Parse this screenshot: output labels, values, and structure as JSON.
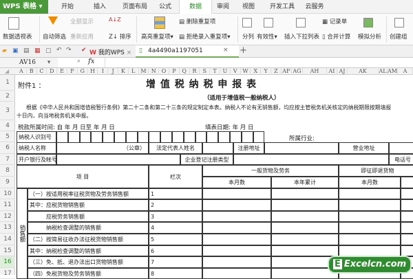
{
  "app": {
    "name": "WPS 表格"
  },
  "ribbon_tabs": [
    "开始",
    "插入",
    "页面布局",
    "公式",
    "数据",
    "审阅",
    "视图",
    "开发工具",
    "云服务"
  ],
  "ribbon": {
    "pivot": "数据透视表",
    "autofilter": "自动筛选",
    "show_all": "全部显示",
    "reapply": "重新应用",
    "sort": "排序",
    "highlight_dup": "高亮重复项",
    "delete_dup": "删除重复项",
    "reject_dup": "拒绝录入重复项",
    "split": "分列",
    "validity": "有效性",
    "insert_dropdown": "插入下拉列表",
    "record": "记录单",
    "consolidate": "合并计算",
    "whatif": "模拟分析",
    "group": "创建组"
  },
  "doc_tabs": {
    "home": "我的WPS",
    "file": "4a4490a1197051"
  },
  "formula": {
    "cell_ref": "AV16",
    "fx": "fx",
    "value": ""
  },
  "columns": [
    "A",
    "B",
    "C",
    "D",
    "E",
    "F",
    "G",
    "H",
    "I",
    "J",
    "K",
    "L",
    "M",
    "N",
    "O",
    "P",
    "Q",
    "R",
    "S",
    "T",
    "U",
    "V",
    "W",
    "X",
    "Y",
    "Z",
    "AF",
    "AG",
    "AH",
    "AI",
    "AJ",
    "AK",
    "AL",
    "AM",
    "A"
  ],
  "rows": [
    "1",
    "2",
    "3",
    "4",
    "5",
    "6",
    "7",
    "8",
    "9",
    "10",
    "11",
    "12",
    "13",
    "14",
    "15",
    "16",
    "17"
  ],
  "sheet": {
    "attachment": "附件1 ：",
    "title": "增 值 税 纳 税 申 报 表",
    "subtitle": "（适用于增值税一般纳税人）",
    "intro1": "根据《中华人民共和国增值税暂行条例》第二十二条和第二十三条的规定制定本表。纳税人不论有无销售额，均应按主管税务机关核定的纳税期限按期填报",
    "intro2": "十日内，向当地税务机关申报。",
    "period": "税款所属时间:  自    年    月    日至    年    月    日",
    "fill_date": "填表日期:    年   月  日",
    "taxpayer_id": "纳税人识别号",
    "industry": "所属行业:",
    "taxpayer_name": "纳税人名称",
    "seal": "（公章）",
    "legal_rep": "法定代表人姓名",
    "reg_addr": "注册地址",
    "biz_addr": "营业地址",
    "bank": "开户银行及帐号",
    "reg_type": "企业登记注册类型",
    "phone": "电话号",
    "item": "项    目",
    "col_no": "栏次",
    "general": "一般货物及劳务",
    "immediate": "即征即退货物",
    "month": "本月数",
    "year": "本年累计",
    "month2": "本月数",
    "sales_group": "销售额",
    "items": [
      {
        "label": "（一）按适用税率征税货物及劳务销售额",
        "no": "1"
      },
      {
        "label": "其中：应税货物销售额",
        "no": "2"
      },
      {
        "label": "　　　应税劳务销售额",
        "no": "3"
      },
      {
        "label": "　　　纳税检查调整的销售额",
        "no": "4"
      },
      {
        "label": "（二）按简易征收办法征税货物销售额",
        "no": "5"
      },
      {
        "label": "其中：纳税检查调整的销售额",
        "no": "6"
      },
      {
        "label": "（三）免、抵、退办法出口货物销售额",
        "no": "7"
      },
      {
        "label": "（四）免税货物及劳务销售额",
        "no": "8"
      }
    ]
  },
  "watermark": "Excelcn.com"
}
